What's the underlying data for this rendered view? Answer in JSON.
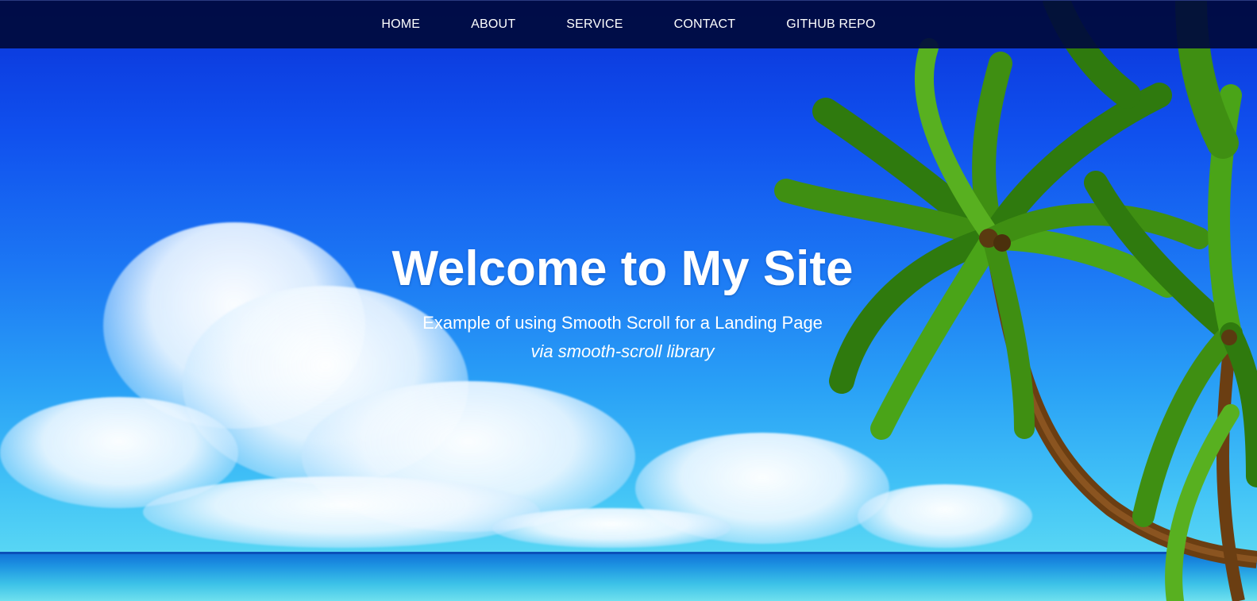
{
  "nav": {
    "items": [
      {
        "label": "HOME"
      },
      {
        "label": "ABOUT"
      },
      {
        "label": "SERVICE"
      },
      {
        "label": "CONTACT"
      },
      {
        "label": "GITHUB REPO"
      }
    ]
  },
  "hero": {
    "title": "Welcome to My Site",
    "subtitle": "Example of using Smooth Scroll for a Landing Page",
    "tagline": "via smooth-scroll library"
  },
  "colors": {
    "navbar_bg": "#000a3c",
    "text": "#ffffff",
    "sky_top": "#0a32d8",
    "sky_bottom": "#58d6f4",
    "palm_leaf": "#3f8f12"
  },
  "background": {
    "scene": [
      "sky",
      "clouds",
      "ocean",
      "palm-tree"
    ]
  }
}
